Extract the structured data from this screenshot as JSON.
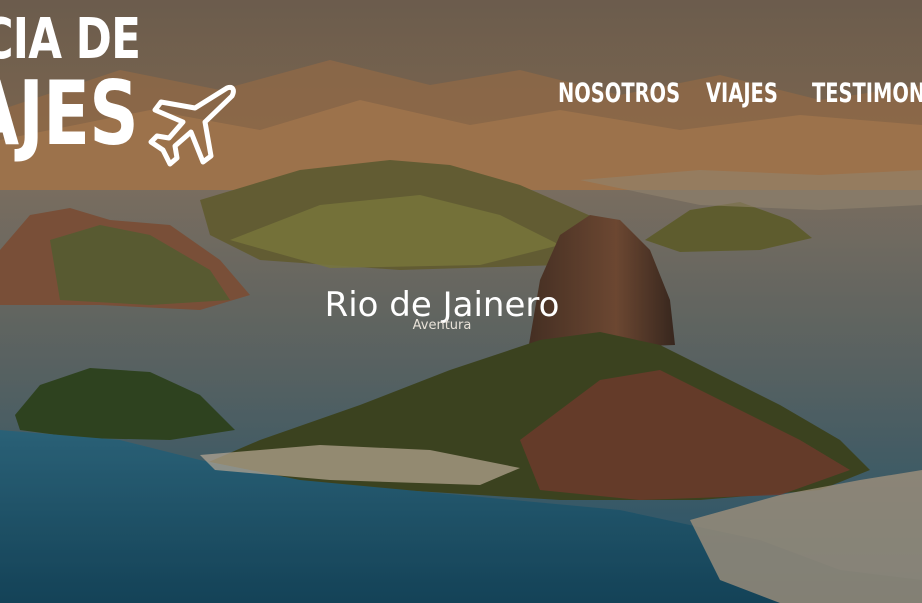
{
  "brand": {
    "line1": "ICIA DE",
    "line2": "AJES",
    "icon": "airplane-icon"
  },
  "nav": {
    "items": [
      {
        "label": "NOSOTROS"
      },
      {
        "label": "VIAJES"
      },
      {
        "label": "TESTIMONI"
      }
    ]
  },
  "hero": {
    "title": "Rio de Jainero",
    "subtitle": "Aventura"
  },
  "colors": {
    "overlay": "#3a2e22",
    "text": "#ffffff"
  }
}
